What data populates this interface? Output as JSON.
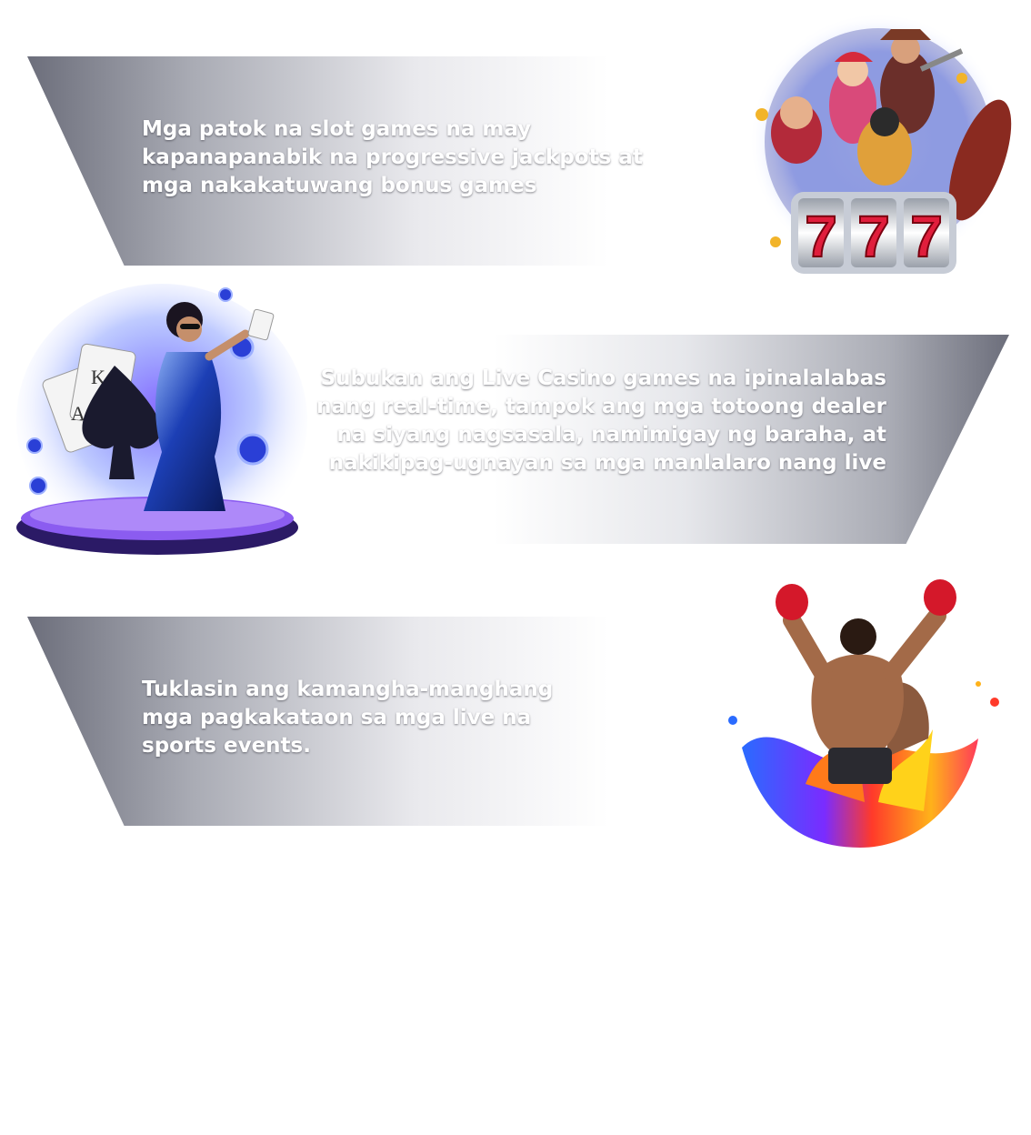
{
  "sections": [
    {
      "text": "Mga patok na slot games na may kapanapanabik na progressive jackpots at mga nakakatuwang bonus games"
    },
    {
      "text": "Subukan ang Live Casino games na ipinalalabas nang real-time, tampok ang mga totoong dealer na siyang nagsasala, namimigay ng baraha, at nakikipag-ugnayan sa mga manlalaro nang live"
    },
    {
      "text": "Tuklasin ang kamangha-manghang mga pagkakataon sa mga live na sports events."
    }
  ],
  "images": [
    {
      "icon": "slot-machine-777-icon",
      "reels": [
        "7",
        "7",
        "7"
      ]
    },
    {
      "icon": "live-dealer-icon",
      "cards": [
        "A",
        "K"
      ]
    },
    {
      "icon": "boxer-icon"
    }
  ]
}
